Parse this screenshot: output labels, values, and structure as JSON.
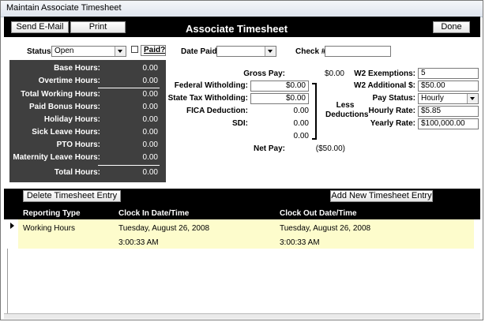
{
  "window": {
    "title": "Maintain Associate Timesheet"
  },
  "header": {
    "send_email": "Send E-Mail",
    "print": "Print",
    "title": "Associate Timesheet",
    "done": "Done"
  },
  "status": {
    "label": "Status:",
    "value": "Open",
    "paid_label": "Paid?"
  },
  "date_paid": {
    "label": "Date Paid:",
    "value": ""
  },
  "check": {
    "label": "Check #:",
    "value": ""
  },
  "hours": [
    {
      "label": "Base Hours:",
      "value": "0.00"
    },
    {
      "label": "Overtime Hours:",
      "value": "0.00"
    },
    {
      "label": "Total Working Hours:",
      "value": "0.00"
    },
    {
      "label": "Paid Bonus Hours:",
      "value": "0.00"
    },
    {
      "label": "Holiday Hours:",
      "value": "0.00"
    },
    {
      "label": "Sick Leave Hours:",
      "value": "0.00"
    },
    {
      "label": "PTO Hours:",
      "value": "0.00"
    },
    {
      "label": "Maternity Leave Hours:",
      "value": "0.00"
    },
    {
      "label": "Total Hours:",
      "value": "0.00"
    }
  ],
  "pay": {
    "gross_label": "Gross Pay:",
    "gross_value": "$0.00",
    "federal_label": "Federal Witholding:",
    "federal_value": "$0.00",
    "state_label": "State Tax Witholding:",
    "state_value": "$0.00",
    "fica_label": "FICA Deduction:",
    "fica_value": "0.00",
    "sdi_label": "SDI:",
    "sdi_value": "0.00",
    "other_value": "0.00",
    "less_deductions": "Less Deductions",
    "net_label": "Net Pay:",
    "net_value": "($50.00)"
  },
  "w2": {
    "exemptions_label": "W2 Exemptions:",
    "exemptions_value": "5",
    "additional_label": "W2 Additional $:",
    "additional_value": "$50.00",
    "pay_status_label": "Pay Status:",
    "pay_status_value": "Hourly",
    "hourly_rate_label": "Hourly Rate:",
    "hourly_rate_value": "$5.85",
    "yearly_rate_label": "Yearly Rate:",
    "yearly_rate_value": "$100,000.00"
  },
  "entries": {
    "delete_label": "Delete Timesheet Entry",
    "add_label": "Add New Timesheet Entry",
    "columns": [
      "Reporting Type",
      "Clock In Date/Time",
      "Clock Out Date/Time"
    ],
    "rows": [
      {
        "type": "Working Hours",
        "clock_in_date": "Tuesday, August 26, 2008",
        "clock_in_time": "3:00:33 AM",
        "clock_out_date": "Tuesday, August 26, 2008",
        "clock_out_time": "3:00:33 AM"
      }
    ]
  }
}
